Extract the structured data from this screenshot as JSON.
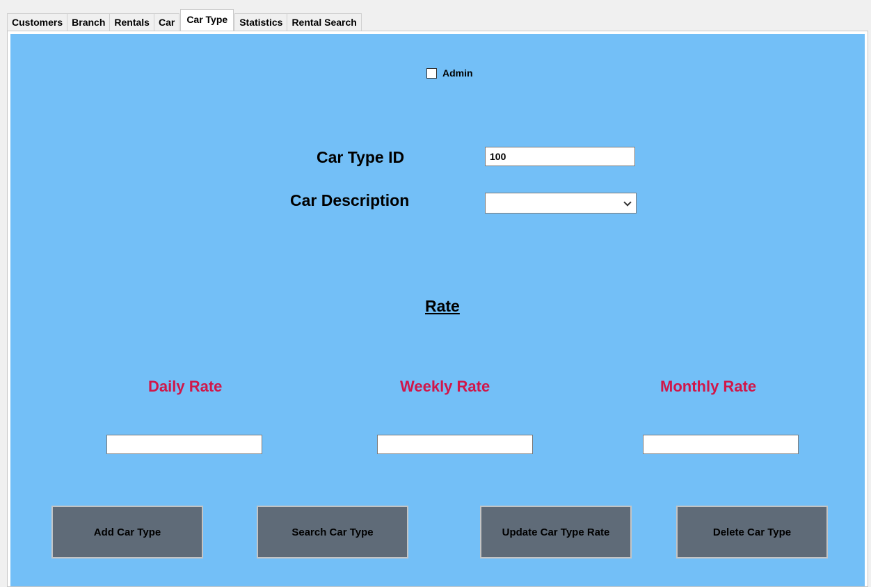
{
  "tabs": [
    {
      "label": "Customers"
    },
    {
      "label": "Branch"
    },
    {
      "label": "Rentals"
    },
    {
      "label": "Car"
    },
    {
      "label": "Car Type",
      "active": true
    },
    {
      "label": "Statistics"
    },
    {
      "label": "Rental Search"
    }
  ],
  "admin": {
    "label": "Admin",
    "checked": false
  },
  "form": {
    "car_type_id_label": "Car Type ID",
    "car_type_id_value": "100",
    "car_description_label": "Car Description",
    "car_description_value": ""
  },
  "rate": {
    "title": "Rate",
    "daily_label": "Daily Rate",
    "weekly_label": "Weekly Rate",
    "monthly_label": "Monthly Rate",
    "daily_value": "",
    "weekly_value": "",
    "monthly_value": ""
  },
  "buttons": {
    "add": "Add Car Type",
    "search": "Search Car Type",
    "update": "Update Car Type Rate",
    "delete": "Delete Car Type"
  },
  "colors": {
    "panel_background": "#73bff7",
    "rate_label": "#d0174a",
    "button_background": "#5f6b78"
  }
}
